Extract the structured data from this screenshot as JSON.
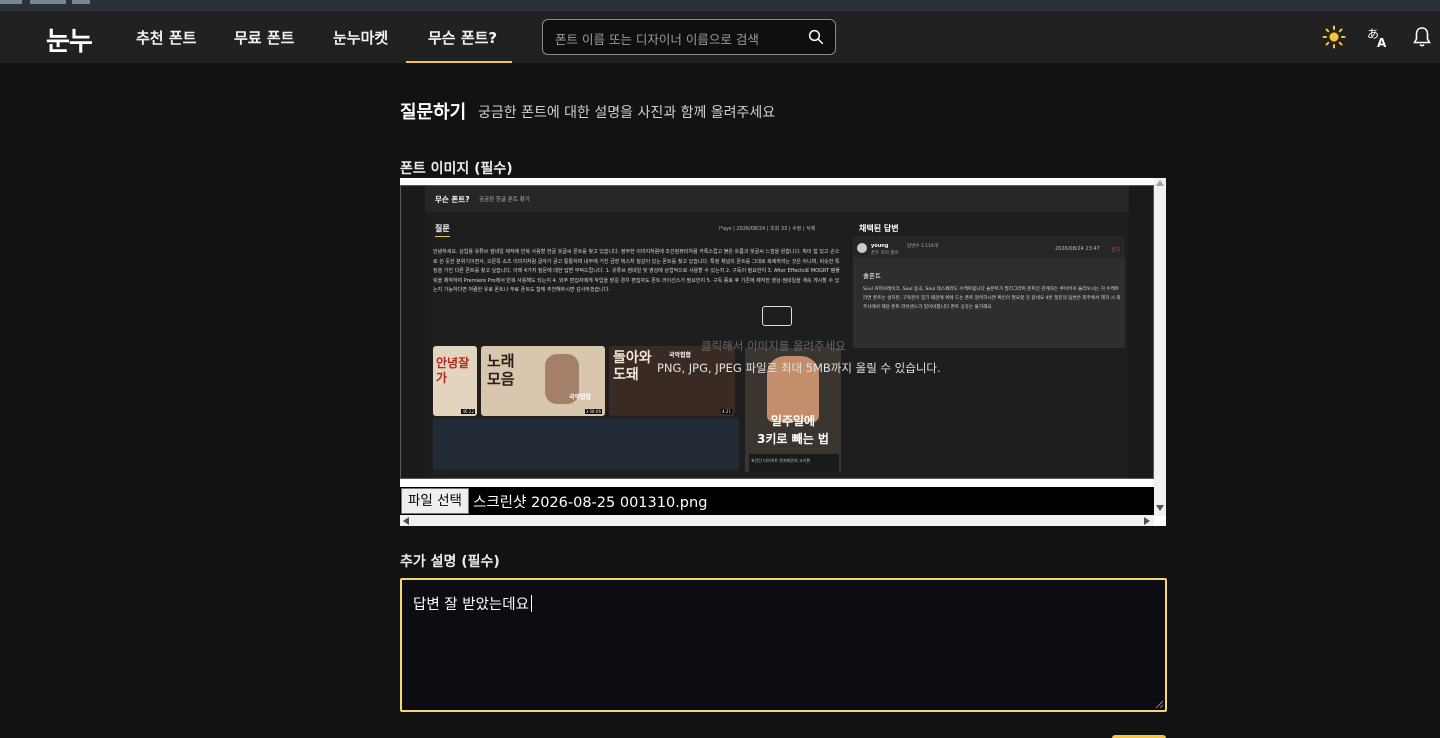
{
  "header": {
    "logo": "눈누",
    "nav": [
      {
        "label": "추천 폰트"
      },
      {
        "label": "무료 폰트"
      },
      {
        "label": "눈누마켓"
      },
      {
        "label": "무슨 폰트?"
      }
    ],
    "search_placeholder": "폰트 이름 또는 디자이너 이름으로 검색",
    "icons": [
      "search-icon",
      "sun-icon",
      "translate-icon",
      "bell-icon"
    ],
    "accent": "#f5c542"
  },
  "page": {
    "title": "질문하기",
    "subtitle": "궁금한 폰트에 대한 설명을 사진과 함께 올려주세요"
  },
  "image_field": {
    "label": "폰트 이미지 (필수)",
    "file_button": "파일 선택",
    "file_name": "스크린샷 2026-08-25 001310.png",
    "hint_1": "클릭해서 이미지를 올려주세요",
    "hint_2": "PNG, JPG, JPEG 파일로 최대 5MB까지 올릴 수 있습니다."
  },
  "preview": {
    "title": "무슨 폰트?",
    "subtitle": "궁금한 한글 폰트 찾기",
    "question_tab": "질문",
    "answer_tab": "채택된 답변",
    "meta": "l*ays | 2026/08/24 | 조회 33 | 수정 | 삭제",
    "answer_user": "young",
    "answer_user_sub": "답변수 3.11K개",
    "answer_user_note": "폰트 조아 짱이",
    "answer_date": "2026/08/24 23:47",
    "answer_report": "신고",
    "answer_font": "솔폰트",
    "answer_text": "Soul 커피브레이크, Soul 용곡, Soul 데스페라도 수케트립니다 솔폰트가 필리그라피 폰트인 관계하는 쿠이어서 둘러보시는 거 수케트라면 폰트는 설치된, 구독된이 있기 때문에 위에 드는 폰트 알려하시면 확인이 필요할 것 같네요 4번 질문의 답변은 외주에서 제작 시 외주사에서 해당 폰트 라이센스가 있어야합니다 폰트 공유는 불가해요",
    "question_text": "안녕하세요. 상업용 유튜브 썸네일 제작에 반복 사용할 한글 붓글씨 폰트를 찾고 있습니다. 정부한 이미지처럼에 조선컴퓨터처럼 카톡스럽고 붉은 흐름과 붓글씨 느낌을 원합니다. 획이 힘 있고 손으로 쓴 듯한 분위기이면서, 오른쪽 쇼츠 이미지처럼 글자가 굵고 통통하며 내부에 거친 금장 텍스처 질감이 있는 폰트를 찾고 있습니다. 특정 채널의 폰트를 그대로 복제하려는 것은 아니며, 비슷한 특징을 가진 다른 폰트를 찾고 싶습니다. 아래 4가지 질문에 대한 답변 부탁드립니다. 1. 유튜브 썸네일 및 영상에 상업적으로 사용할 수 있는지 2. 구독이 필요한지 3. After Effects로 MOGRT 템플릿을 제작하여 Premiere Pro에서 반복 사용해도 되는지 4. 외주 편집자에게 작업을 맡길 경우 편집자도 폰트 라이선스가 필요한지 5. 구독 종료 후 기존에 제작한 영상·썸네일을 계속 게시할 수 있는지 가능하다면 저렴한 유료 폰트나 무료 폰트도 함께 추천해주시면 감사하겠습니다.",
    "thumb_1": "안녕잘가",
    "thumb_1_time": "46:22",
    "thumb_2": "노래모음",
    "thumb_2_sub": "국악힙합",
    "thumb_2_time": "3:08:06",
    "thumb_3": "돌아와도돼",
    "thumb_3_sub": "국악힙합",
    "thumb_3_time": "4:21",
    "ad_text_1": "일주일에",
    "ad_text_2": "3키로 빼는 법",
    "ad_caption": "초간단 다이어트 한지피민지 고기편"
  },
  "description_field": {
    "label": "추가 설명 (필수)",
    "value": "답변 잘 받았는데요"
  }
}
